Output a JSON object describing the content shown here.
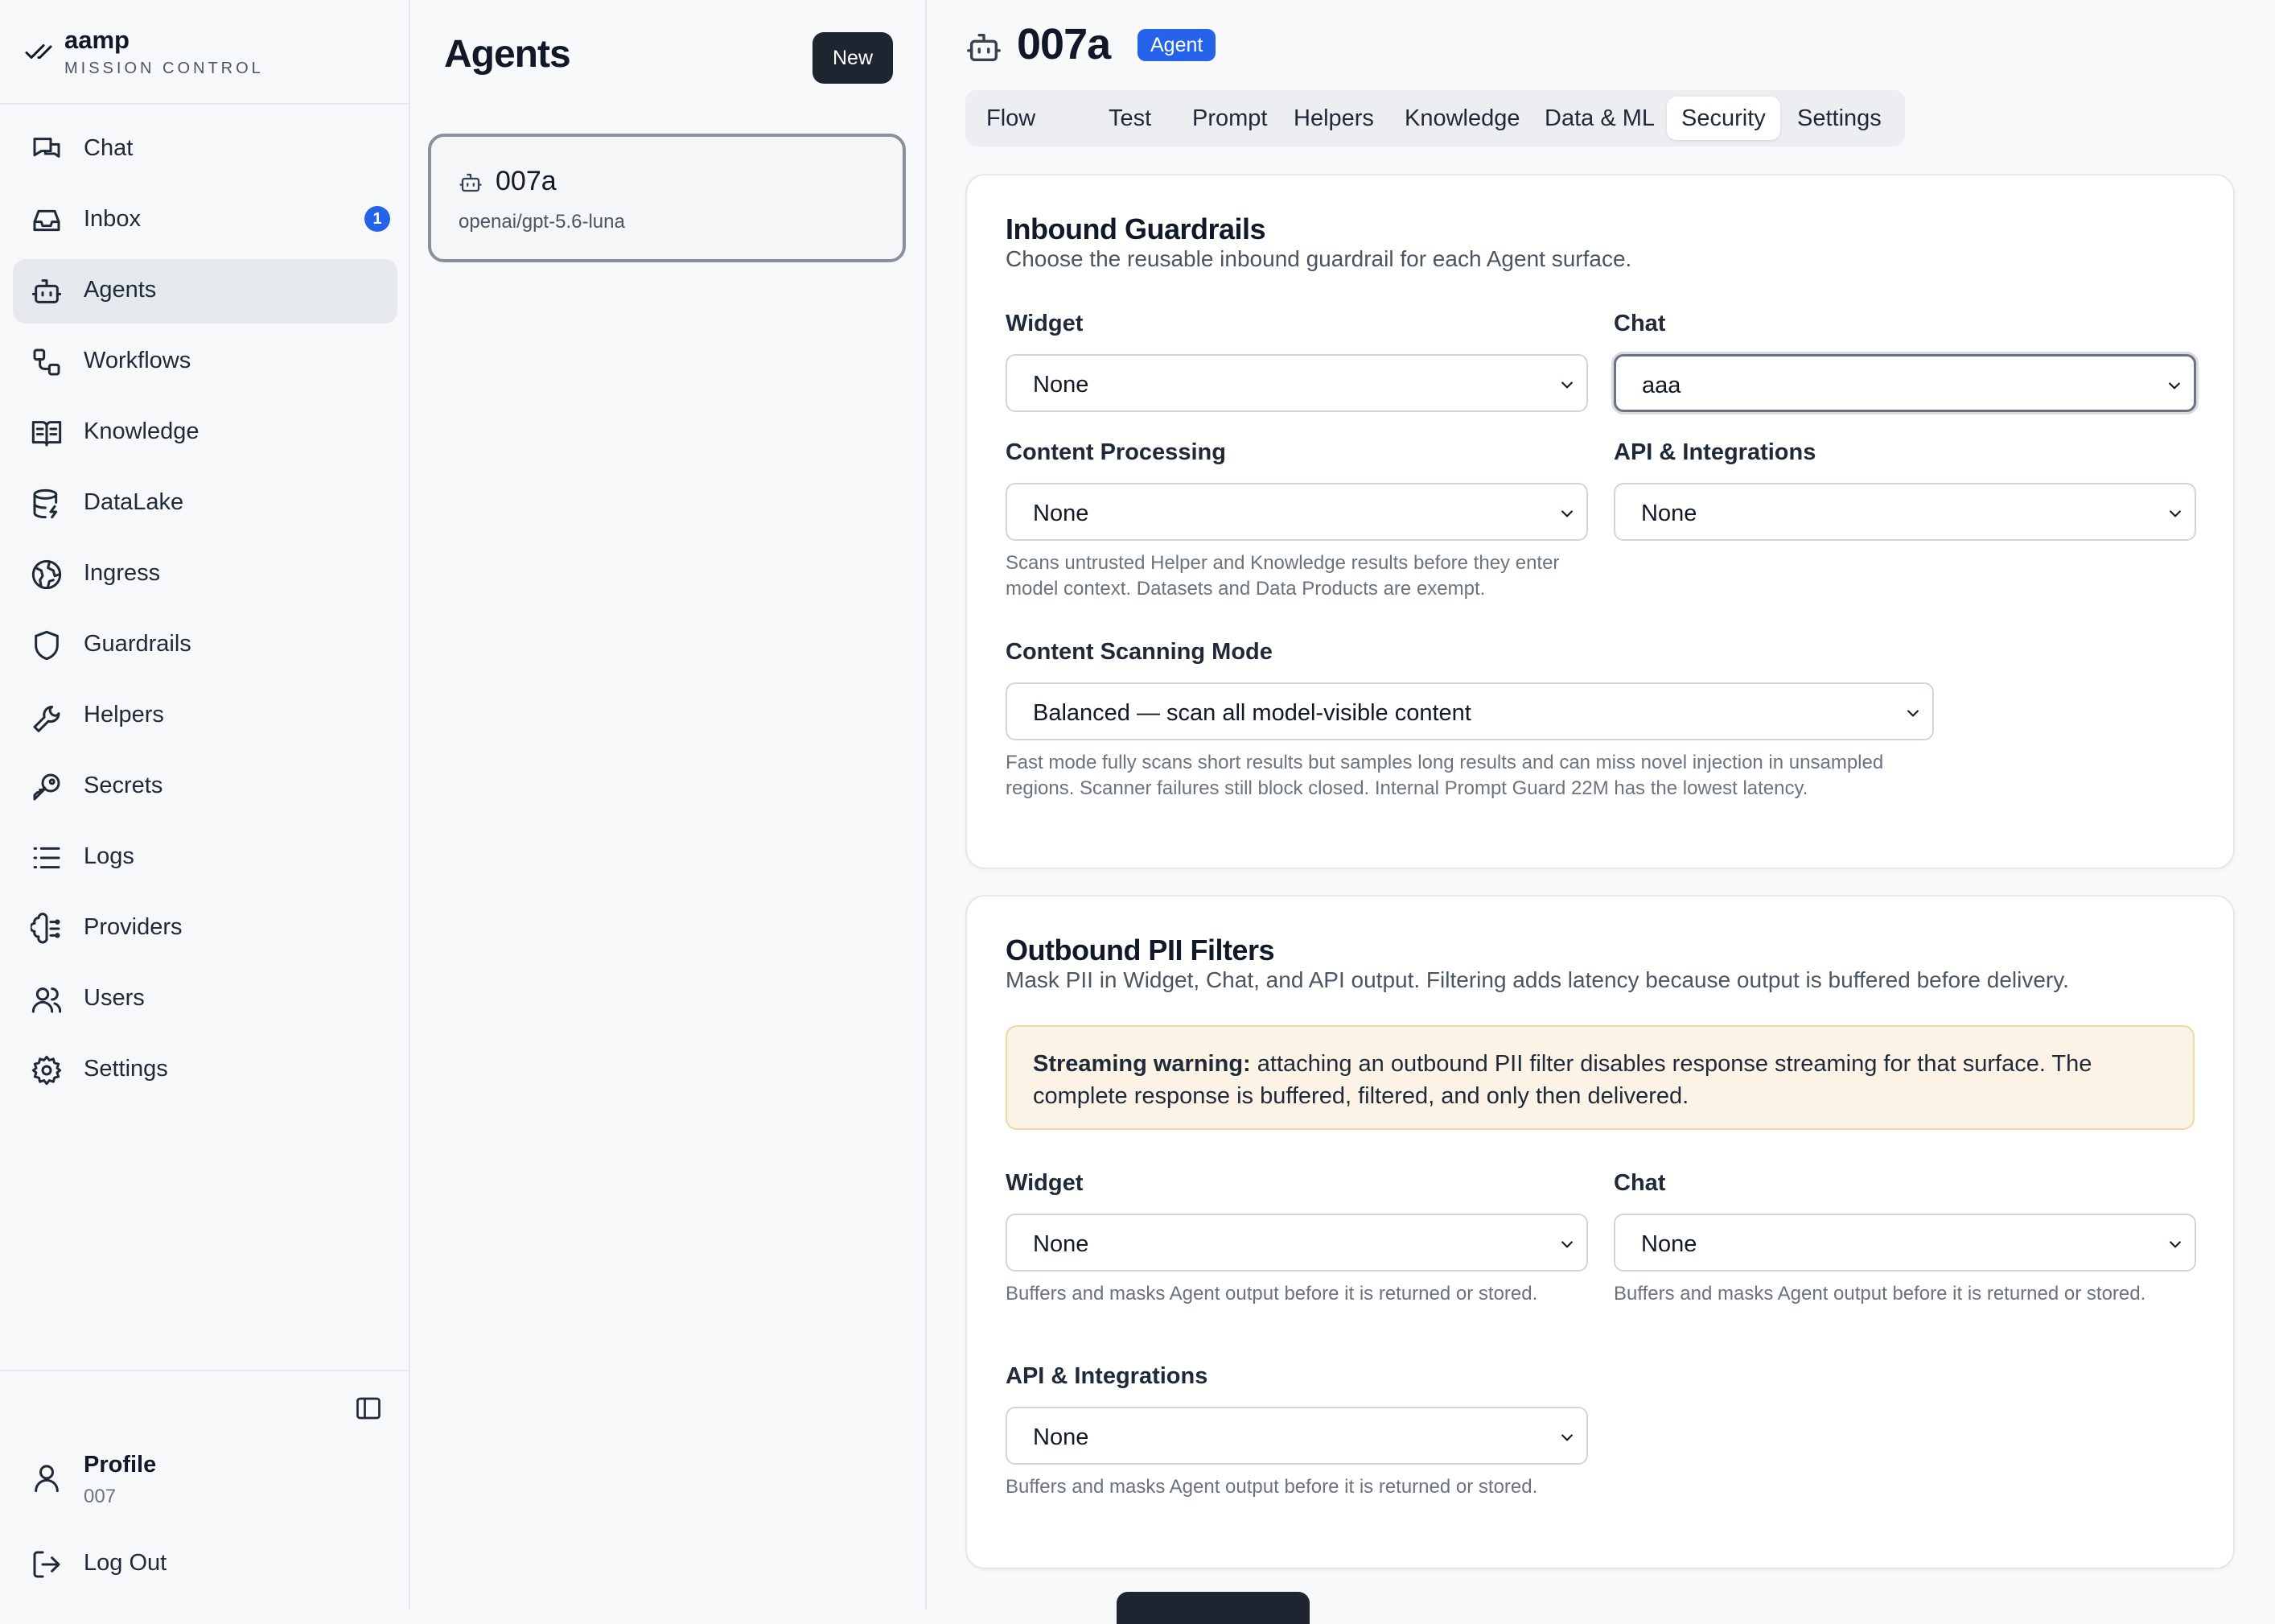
{
  "brand": {
    "name": "aamp",
    "subtitle": "MISSION CONTROL"
  },
  "sidebar": {
    "items": [
      {
        "label": "Chat",
        "icon": "chat-icon"
      },
      {
        "label": "Inbox",
        "icon": "inbox-icon",
        "badge": "1"
      },
      {
        "label": "Agents",
        "icon": "bot-icon",
        "active": true
      },
      {
        "label": "Workflows",
        "icon": "workflow-icon"
      },
      {
        "label": "Knowledge",
        "icon": "book-open-icon"
      },
      {
        "label": "DataLake",
        "icon": "database-icon"
      },
      {
        "label": "Ingress",
        "icon": "globe-icon"
      },
      {
        "label": "Guardrails",
        "icon": "shield-icon"
      },
      {
        "label": "Helpers",
        "icon": "wrench-icon"
      },
      {
        "label": "Secrets",
        "icon": "key-icon"
      },
      {
        "label": "Logs",
        "icon": "list-icon"
      },
      {
        "label": "Providers",
        "icon": "brain-icon"
      },
      {
        "label": "Users",
        "icon": "users-icon"
      },
      {
        "label": "Settings",
        "icon": "gear-icon"
      }
    ],
    "profile": {
      "name": "Profile",
      "sub": "007"
    },
    "logout": "Log Out"
  },
  "agents": {
    "title": "Agents",
    "new_label": "New",
    "list": [
      {
        "name": "007a",
        "model": "openai/gpt-5.6-luna"
      }
    ]
  },
  "main": {
    "title": "007a",
    "badge": "Agent",
    "tabs": [
      "Flow",
      "Test",
      "Prompt",
      "Helpers",
      "Knowledge",
      "Data & ML",
      "Security",
      "Settings"
    ],
    "active_tab": "Security",
    "inbound": {
      "title": "Inbound Guardrails",
      "desc": "Choose the reusable inbound guardrail for each Agent surface.",
      "widget_label": "Widget",
      "widget_value": "None",
      "chat_label": "Chat",
      "chat_value": "aaa",
      "content_label": "Content Processing",
      "content_value": "None",
      "content_help": "Scans untrusted Helper and Knowledge results before they enter model context. Datasets and Data Products are exempt.",
      "api_label": "API & Integrations",
      "api_value": "None",
      "mode_label": "Content Scanning Mode",
      "mode_value": "Balanced — scan all model-visible content",
      "mode_help": "Fast mode fully scans short results but samples long results and can miss novel injection in unsampled regions. Scanner failures still block closed. Internal Prompt Guard 22M has the lowest latency."
    },
    "outbound": {
      "title": "Outbound PII Filters",
      "desc": "Mask PII in Widget, Chat, and API output. Filtering adds latency because output is buffered before delivery.",
      "warning_bold": "Streaming warning:",
      "warning_text": " attaching an outbound PII filter disables response streaming for that surface. The complete response is buffered, filtered, and only then delivered.",
      "widget_label": "Widget",
      "widget_value": "None",
      "widget_help": "Buffers and masks Agent output before it is returned or stored.",
      "chat_label": "Chat",
      "chat_value": "None",
      "chat_help": "Buffers and masks Agent output before it is returned or stored.",
      "api_label": "API & Integrations",
      "api_value": "None",
      "api_help": "Buffers and masks Agent output before it is returned or stored."
    }
  },
  "colors": {
    "accent": "#2563eb",
    "dark_button": "#1e2530",
    "warning_bg": "#fbf4e6",
    "warning_border": "#efd7a8"
  }
}
